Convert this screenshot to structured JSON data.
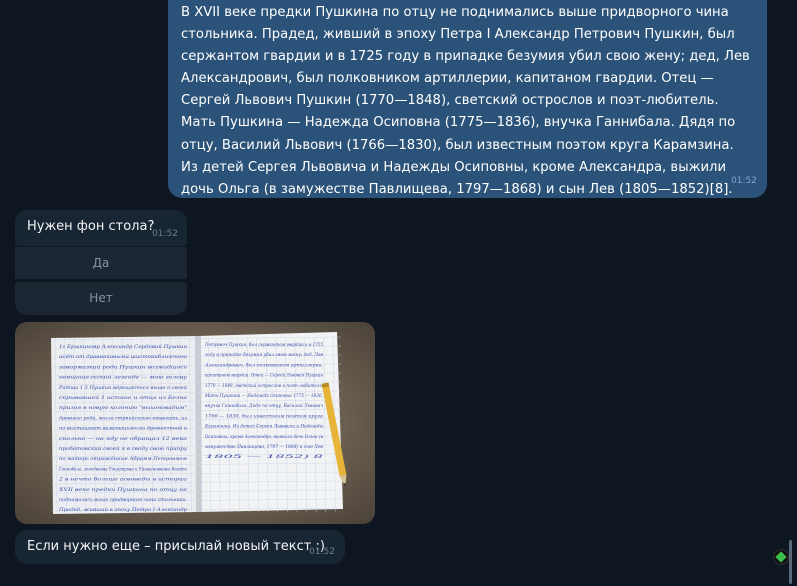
{
  "outgoing": {
    "text": "В XVII веке предки Пушкина по отцу не поднимались выше придворного чина стольника. Прадед, живший в эпоху Петра I Александр Петрович Пушкин, был сержантом гвардии и в 1725 году в припадке безумия убил свою жену; дед, Лев Александрович, был полковником артиллерии, капитаном гвардии. Отец — Сергей Львович Пушкин (1770—1848), светский острослов и поэт-любитель. Мать Пушкина — Надежда Осиповна (1775—1836), внучка Ганнибала. Дядя по отцу, Василий Львович (1766—1830), был известным поэтом круга Карамзина. Из детей Сергея Львовича и Надежды Осиповны, кроме Александра, выжили дочь Ольга (в замужестве Павлищева, 1797—1868) и сын Лев (1805—1852)[8].",
    "time": "01:52"
  },
  "question": {
    "text": "Нужен фон стола?",
    "time": "01:52",
    "buttons": [
      "Да",
      "Нет"
    ]
  },
  "photo": {
    "left_page_lines": [
      "1z Бршкиновр Александр Сердовий Пушкин",
      "исёт от дравнековымй шистокиблизского",
      "завормазкий рода Пушкин возмидшось",
      "невшашельский легенде — мою голову",
      "Ратша 1 5   Пушкин вёрецаеться выше о своей",
      "скрывавшей 1 истине и отца из Безна",
      "призоя в новую колонию \"выхоновадим\"",
      "древнего рода, могла стрпийскгиго отвегить, из",
      "по высташают важовацьгеолы древностной и",
      "сколько — на яду не обращал 12 века",
      "пробатовский своей я в своду свою припру",
      "по матерь     отражённые Абрамм Петровмом",
      "Ганнибала, генедвнова Уоцеркрова и Уйовшновновы богато",
      "2 в нечто больше асвоведы в истории",
      "  XVII веке предки Пушкина по отцу не",
      "поднимались выше придворного чина стольника.",
      "Прадед, живший в эпоху Петра I Александр"
    ],
    "right_page_lines": [
      "Петрович Пушкин, был сержантом гвардии и в 1725",
      "году в припадке безумия убил свою жену; дед, Лев",
      "Александрович, был полковником артиллерии,",
      "капитаном гвардии. Отец —   Сергей Львович Пушкин",
      "1770 — 1848, светский острослов и поэт-любитель.",
      "Мать Пушкина — Надежда Осиповна 1775 — 1836,",
      "внучка Ганнибала. Дядя по отцу, Василий Львович",
      "1766 — 1830, был известным поэтом круга",
      "Карамзина. Из детей Сергея Львовича и Надежды",
      "Осиповны, кроме Александра, выжили дочь Ольга (в",
      "замужестве Павлищева, 1797 — 1868) и сын Лев",
      "1805 — 1852) 8"
    ]
  },
  "last": {
    "text": "Если нужно еще – присылай новый текст :)",
    "time": "01:52"
  },
  "colors": {
    "background": "#0e1621",
    "outgoing_bubble": "#2b5278",
    "incoming_bubble": "#182533",
    "ink": "#3a4ea8",
    "pencil": "#e7b43a"
  },
  "icons": {
    "corner_badge": "green-diamond-icon"
  }
}
